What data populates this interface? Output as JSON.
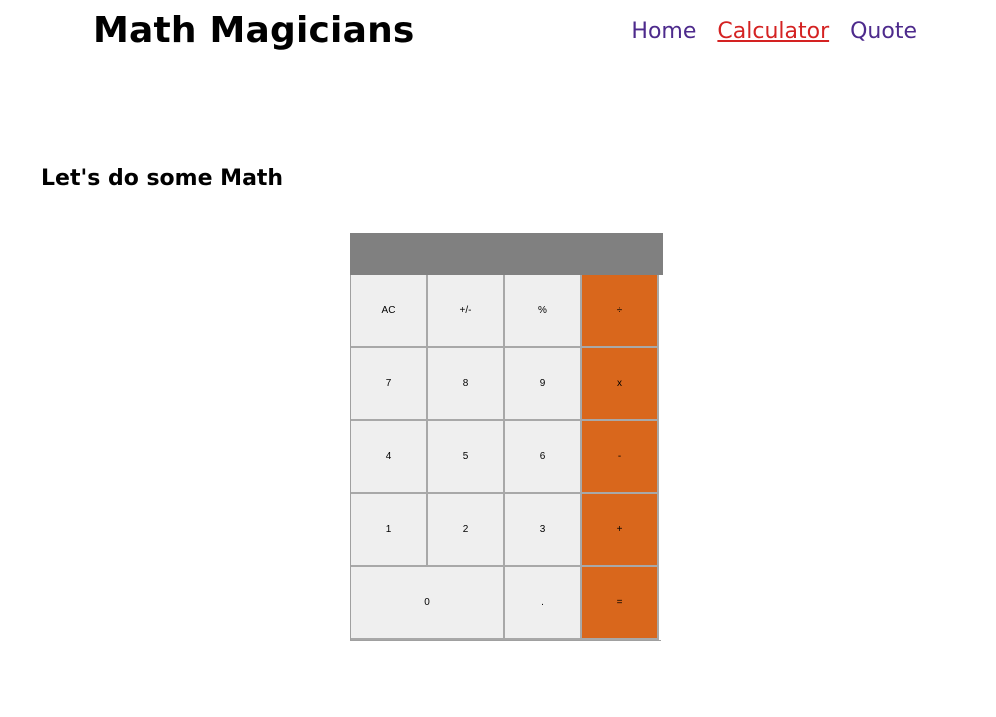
{
  "header": {
    "logo": "Math Magicians",
    "nav": {
      "home": "Home",
      "calculator": "Calculator",
      "quote": "Quote"
    }
  },
  "main": {
    "heading": "Let's do some Math"
  },
  "calculator": {
    "display": "",
    "keys": {
      "ac": "AC",
      "plus_minus": "+/-",
      "percent": "%",
      "divide": "÷",
      "seven": "7",
      "eight": "8",
      "nine": "9",
      "multiply": "x",
      "four": "4",
      "five": "5",
      "six": "6",
      "subtract": "-",
      "one": "1",
      "two": "2",
      "three": "3",
      "add": "+",
      "zero": "0",
      "decimal": ".",
      "equals": "="
    }
  },
  "colors": {
    "operator": "#d9671c",
    "display": "#808080",
    "key": "#efefef",
    "nav_link": "#4d2a8c",
    "nav_active": "#d42222"
  }
}
